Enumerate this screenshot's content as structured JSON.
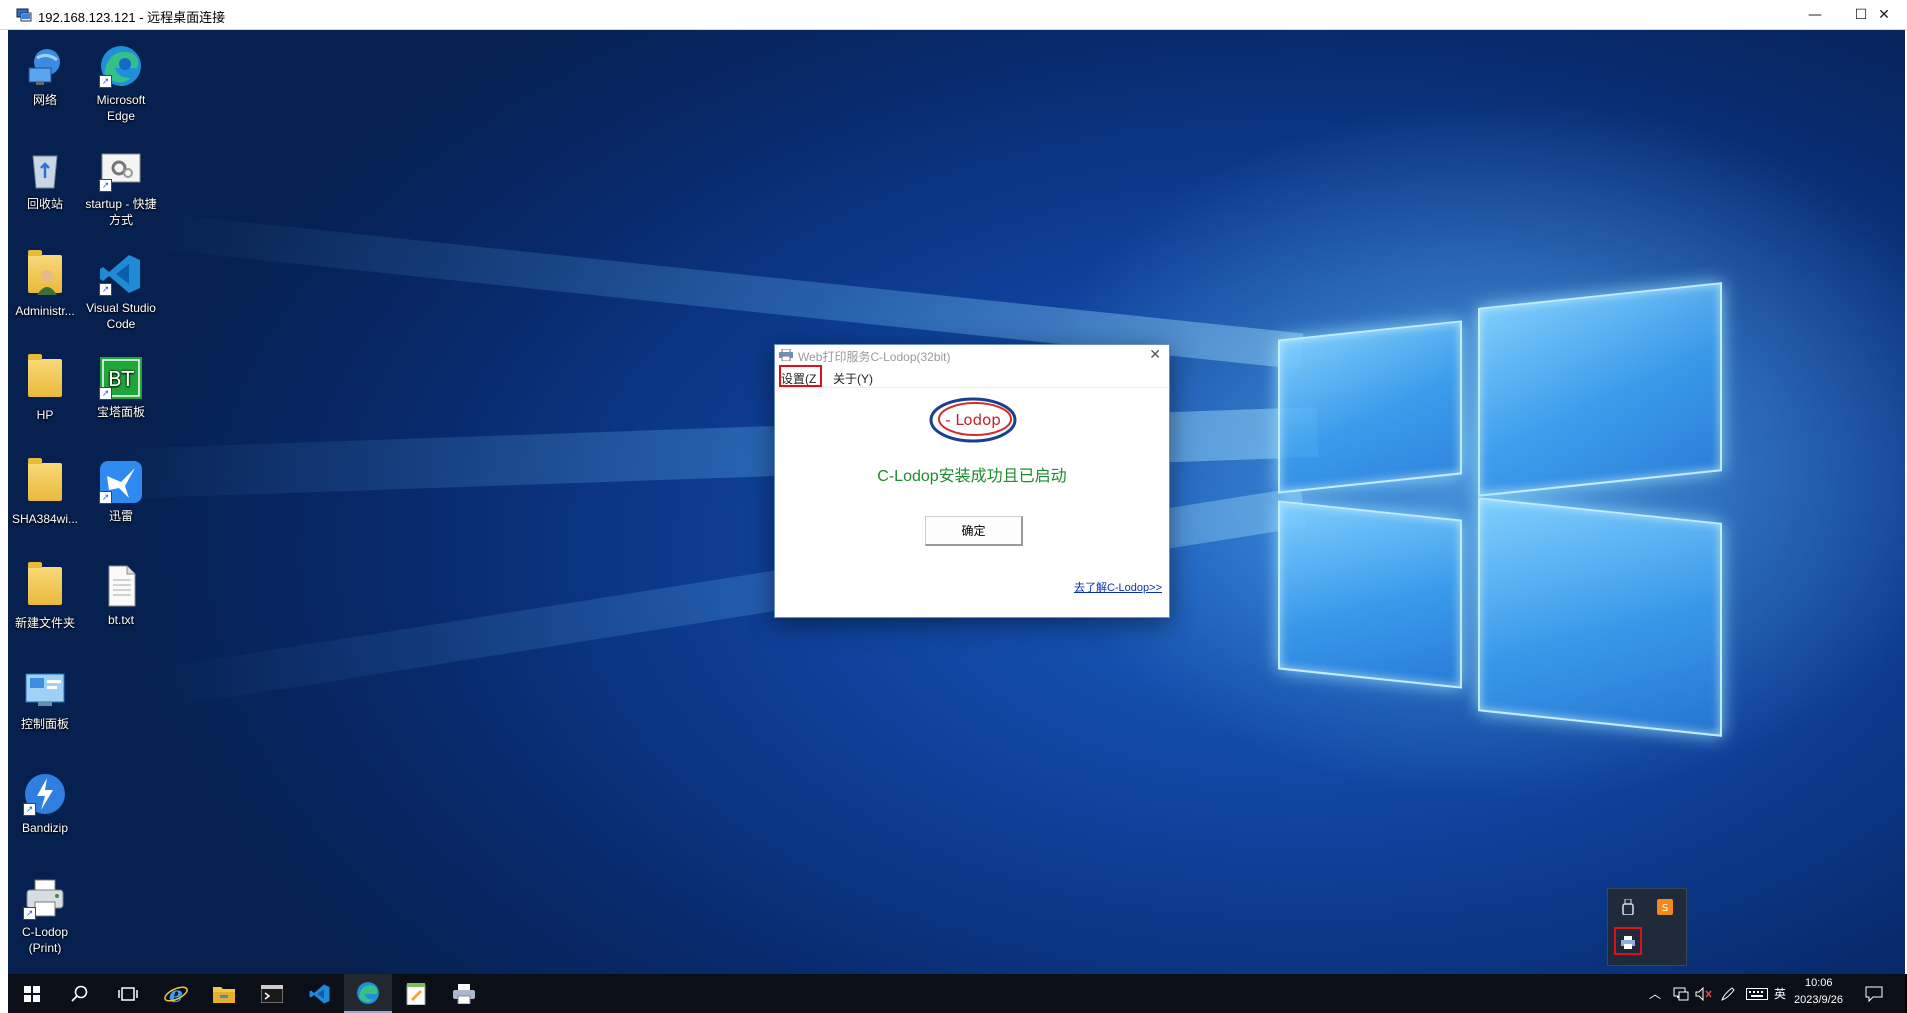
{
  "window": {
    "title": "192.168.123.121 - 远程桌面连接",
    "minimize_glyph": "—",
    "maximize_glyph": "☐",
    "close_glyph": "✕"
  },
  "desktop_icons": [
    {
      "label": "网络",
      "icon": "network-icon"
    },
    {
      "label": "Microsoft Edge",
      "icon": "edge-icon"
    },
    {
      "label": "回收站",
      "icon": "recycle-bin-icon"
    },
    {
      "label": "startup - 快捷方式",
      "icon": "startup-shortcut-icon"
    },
    {
      "label": "Administr...",
      "icon": "user-folder-icon"
    },
    {
      "label": "Visual Studio Code",
      "icon": "vscode-icon"
    },
    {
      "label": "HP",
      "icon": "folder-icon"
    },
    {
      "label": "宝塔面板",
      "icon": "bt-panel-icon"
    },
    {
      "label": "SHA384wi...",
      "icon": "folder-icon"
    },
    {
      "label": "迅雷",
      "icon": "xunlei-icon"
    },
    {
      "label": "新建文件夹",
      "icon": "folder-icon"
    },
    {
      "label": "bt.txt",
      "icon": "text-file-icon"
    },
    {
      "label": "控制面板",
      "icon": "control-panel-icon"
    },
    {
      "label": "Bandizip",
      "icon": "bandizip-icon"
    },
    {
      "label": "C-Lodop (Print)",
      "icon": "clodop-printer-icon"
    }
  ],
  "dialog": {
    "title": "Web打印服务C-Lodop(32bit)",
    "close_glyph": "✕",
    "menu": {
      "settings": "设置(Z",
      "about": "关于(Y)"
    },
    "logo_text": "- Lodop",
    "message": "C-Lodop安装成功且已启动",
    "ok_label": "确定",
    "learn_link": "去了解C-Lodop>>",
    "message_color": "#1e8a2e"
  },
  "tray_popup": {
    "icons": [
      "usb-icon",
      "sogou-icon",
      "clodop-tray-icon"
    ]
  },
  "taskbar": {
    "items": [
      "start-icon",
      "search-icon",
      "task-view-icon",
      "ie-icon",
      "file-explorer-icon",
      "terminal-icon",
      "vscode-icon",
      "edge-icon",
      "notepad-icon",
      "printer-icon"
    ],
    "ime_label": "英",
    "time": "10:06",
    "date": "2023/9/26"
  },
  "colors": {
    "highlight_box": "#e0101a",
    "desktop_blue": "#0e3f97"
  }
}
